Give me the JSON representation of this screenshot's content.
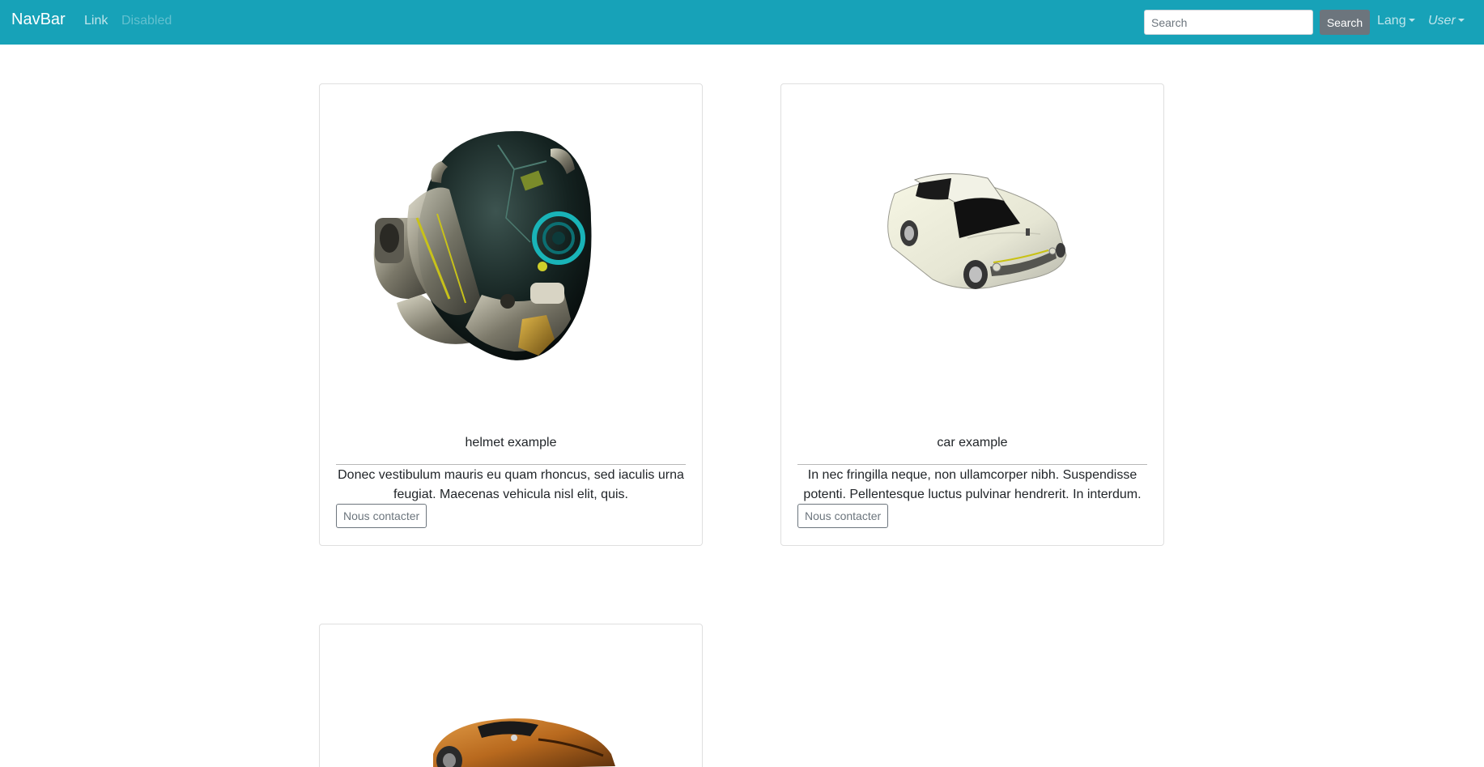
{
  "navbar": {
    "brand": "NavBar",
    "link": "Link",
    "disabled_link": "Disabled",
    "search_placeholder": "Search",
    "search_button": "Search",
    "lang_dropdown": "Lang",
    "user_dropdown": "User",
    "background_color": "#17a2b8"
  },
  "cards": [
    {
      "title": "helmet example",
      "text": "Donec vestibulum mauris eu quam rhoncus, sed iaculis urna feugiat. Maecenas vehicula nisl elit, quis.",
      "button": "Nous contacter",
      "image": "helmet-3d-model"
    },
    {
      "title": "car example",
      "text": "In nec fringilla neque, non ullamcorper nibh. Suspendisse potenti. Pellentesque luctus pulvinar hendrerit. In interdum.",
      "button": "Nous contacter",
      "image": "white-car-3d-model"
    },
    {
      "image": "orange-sports-car-3d-model"
    }
  ]
}
